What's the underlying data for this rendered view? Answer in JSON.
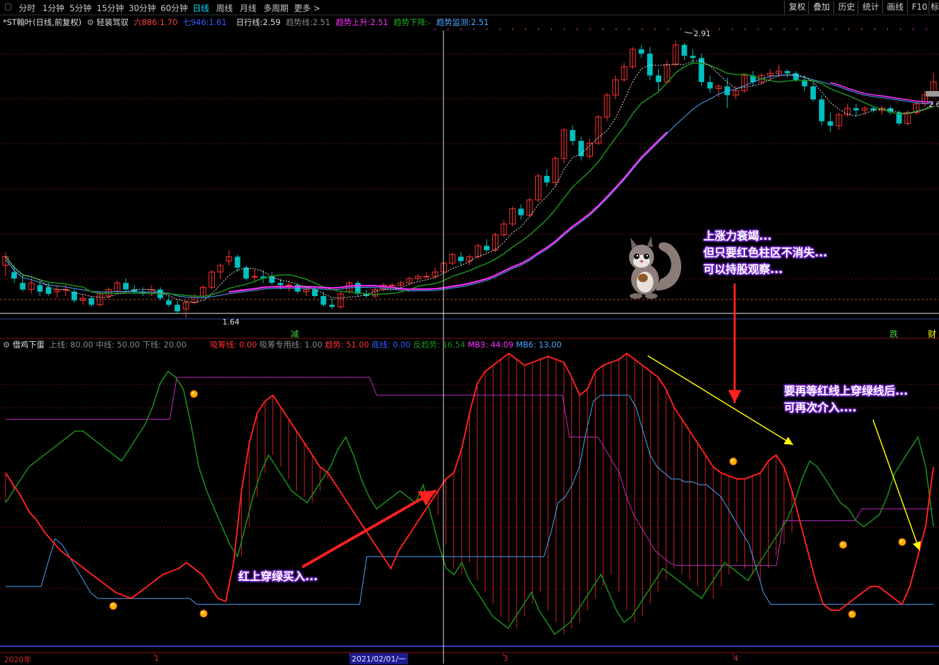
{
  "toolbar": {
    "periods": [
      "分时",
      "1分钟",
      "5分钟",
      "15分钟",
      "30分钟",
      "60分钟",
      "日线",
      "周线",
      "月线",
      "多周期",
      "更多 >"
    ],
    "active_period": "日线",
    "right": [
      "复权",
      "叠加",
      "历史",
      "统计",
      "画线",
      "F10",
      "标"
    ]
  },
  "main_info": {
    "stock": "*ST翰叶(日线,前复权)",
    "indicator": "轻装驾驭",
    "v1_label": "六886:",
    "v1": "1.70",
    "v2_label": "七946:",
    "v2": "1.61",
    "v3_label": "日行线:",
    "v3": "2.59",
    "v4_label": "趋势线:",
    "v4": "2.51",
    "v5_label": "趋势上升:",
    "v5": "2.51",
    "v6_label": "趋势下降:",
    "v6": "-",
    "v7_label": "趋势监测:",
    "v7": "2.51"
  },
  "price_labels": {
    "high": "2.91",
    "low": "1.64",
    "right": "2.6"
  },
  "markers": {
    "m1": "减",
    "m2": "跌",
    "m3": "财"
  },
  "sub_info": {
    "name": "借鸡下蛋",
    "upper": "上线: 80.00",
    "middle": "中线: 50.00",
    "lower": "下线: 20.00",
    "absorb": "吸筹线: 0.00",
    "absorb_special": "吸筹专用线: 1.00",
    "trend": "趋势: 51.00",
    "bottom": "底线: 0.00",
    "reverse": "反趋势: 16.54",
    "mb3": "MB3: 44.09",
    "mb6": "MB6: 13.00"
  },
  "annotations": {
    "a1": [
      "上涨力衰竭...",
      "但只要红色柱区不消失...",
      "可以持股观察..."
    ],
    "a2": [
      "要再等红线上穿绿线后...",
      "可再次介入...."
    ],
    "a3": "红上穿绿买入..."
  },
  "xaxis": {
    "year": "2020年",
    "m1": "1",
    "date": "2021/02/01/一",
    "m3": "3",
    "m4": "4"
  },
  "colors": {
    "up": "#ff3232",
    "down": "#00c0c0",
    "magenta": "#ff30ff",
    "green": "#1a8c1a",
    "blue": "#4aa8ff"
  },
  "chart_data": {
    "type": "candlestick",
    "candles": [
      {
        "o": 1.88,
        "h": 1.94,
        "l": 1.83,
        "c": 1.92
      },
      {
        "o": 1.85,
        "h": 1.88,
        "l": 1.8,
        "c": 1.82
      },
      {
        "o": 1.8,
        "h": 1.84,
        "l": 1.76,
        "c": 1.77
      },
      {
        "o": 1.77,
        "h": 1.82,
        "l": 1.75,
        "c": 1.8
      },
      {
        "o": 1.79,
        "h": 1.81,
        "l": 1.74,
        "c": 1.76
      },
      {
        "o": 1.78,
        "h": 1.8,
        "l": 1.74,
        "c": 1.75
      },
      {
        "o": 1.76,
        "h": 1.79,
        "l": 1.73,
        "c": 1.77
      },
      {
        "o": 1.77,
        "h": 1.79,
        "l": 1.74,
        "c": 1.77
      },
      {
        "o": 1.76,
        "h": 1.77,
        "l": 1.71,
        "c": 1.72
      },
      {
        "o": 1.72,
        "h": 1.75,
        "l": 1.7,
        "c": 1.73
      },
      {
        "o": 1.73,
        "h": 1.74,
        "l": 1.69,
        "c": 1.7
      },
      {
        "o": 1.7,
        "h": 1.76,
        "l": 1.69,
        "c": 1.75
      },
      {
        "o": 1.74,
        "h": 1.78,
        "l": 1.73,
        "c": 1.77
      },
      {
        "o": 1.76,
        "h": 1.81,
        "l": 1.75,
        "c": 1.8
      },
      {
        "o": 1.8,
        "h": 1.82,
        "l": 1.76,
        "c": 1.77
      },
      {
        "o": 1.77,
        "h": 1.79,
        "l": 1.75,
        "c": 1.76
      },
      {
        "o": 1.76,
        "h": 1.78,
        "l": 1.74,
        "c": 1.75
      },
      {
        "o": 1.75,
        "h": 1.79,
        "l": 1.74,
        "c": 1.77
      },
      {
        "o": 1.77,
        "h": 1.78,
        "l": 1.72,
        "c": 1.73
      },
      {
        "o": 1.72,
        "h": 1.74,
        "l": 1.69,
        "c": 1.7
      },
      {
        "o": 1.7,
        "h": 1.72,
        "l": 1.66,
        "c": 1.67
      },
      {
        "o": 1.68,
        "h": 1.72,
        "l": 1.64,
        "c": 1.71
      },
      {
        "o": 1.71,
        "h": 1.75,
        "l": 1.7,
        "c": 1.74
      },
      {
        "o": 1.74,
        "h": 1.79,
        "l": 1.73,
        "c": 1.78
      },
      {
        "o": 1.78,
        "h": 1.86,
        "l": 1.77,
        "c": 1.85
      },
      {
        "o": 1.85,
        "h": 1.89,
        "l": 1.82,
        "c": 1.88
      },
      {
        "o": 1.9,
        "h": 1.95,
        "l": 1.88,
        "c": 1.92
      },
      {
        "o": 1.92,
        "h": 1.93,
        "l": 1.85,
        "c": 1.87
      },
      {
        "o": 1.87,
        "h": 1.88,
        "l": 1.81,
        "c": 1.82
      },
      {
        "o": 1.83,
        "h": 1.86,
        "l": 1.81,
        "c": 1.83
      },
      {
        "o": 1.83,
        "h": 1.86,
        "l": 1.8,
        "c": 1.82
      },
      {
        "o": 1.83,
        "h": 1.85,
        "l": 1.79,
        "c": 1.8
      },
      {
        "o": 1.8,
        "h": 1.82,
        "l": 1.77,
        "c": 1.79
      },
      {
        "o": 1.79,
        "h": 1.81,
        "l": 1.76,
        "c": 1.79
      },
      {
        "o": 1.79,
        "h": 1.8,
        "l": 1.75,
        "c": 1.76
      },
      {
        "o": 1.76,
        "h": 1.78,
        "l": 1.74,
        "c": 1.77
      },
      {
        "o": 1.77,
        "h": 1.78,
        "l": 1.73,
        "c": 1.74
      },
      {
        "o": 1.74,
        "h": 1.76,
        "l": 1.69,
        "c": 1.7
      },
      {
        "o": 1.7,
        "h": 1.73,
        "l": 1.68,
        "c": 1.69
      },
      {
        "o": 1.69,
        "h": 1.76,
        "l": 1.68,
        "c": 1.75
      },
      {
        "o": 1.76,
        "h": 1.81,
        "l": 1.75,
        "c": 1.8
      },
      {
        "o": 1.8,
        "h": 1.81,
        "l": 1.74,
        "c": 1.75
      },
      {
        "o": 1.75,
        "h": 1.77,
        "l": 1.73,
        "c": 1.74
      },
      {
        "o": 1.74,
        "h": 1.78,
        "l": 1.73,
        "c": 1.77
      },
      {
        "o": 1.77,
        "h": 1.8,
        "l": 1.76,
        "c": 1.79
      },
      {
        "o": 1.79,
        "h": 1.8,
        "l": 1.78,
        "c": 1.79
      },
      {
        "o": 1.79,
        "h": 1.81,
        "l": 1.78,
        "c": 1.8
      },
      {
        "o": 1.8,
        "h": 1.83,
        "l": 1.79,
        "c": 1.82
      },
      {
        "o": 1.82,
        "h": 1.84,
        "l": 1.81,
        "c": 1.83
      },
      {
        "o": 1.83,
        "h": 1.85,
        "l": 1.82,
        "c": 1.83
      },
      {
        "o": 1.83,
        "h": 1.87,
        "l": 1.82,
        "c": 1.85
      },
      {
        "o": 1.85,
        "h": 1.9,
        "l": 1.84,
        "c": 1.89
      },
      {
        "o": 1.89,
        "h": 1.94,
        "l": 1.88,
        "c": 1.93
      },
      {
        "o": 1.92,
        "h": 1.94,
        "l": 1.88,
        "c": 1.9
      },
      {
        "o": 1.9,
        "h": 1.93,
        "l": 1.88,
        "c": 1.92
      },
      {
        "o": 1.92,
        "h": 1.98,
        "l": 1.91,
        "c": 1.97
      },
      {
        "o": 1.97,
        "h": 2.0,
        "l": 1.94,
        "c": 1.95
      },
      {
        "o": 1.95,
        "h": 2.03,
        "l": 1.94,
        "c": 2.02
      },
      {
        "o": 2.02,
        "h": 2.09,
        "l": 2.01,
        "c": 2.07
      },
      {
        "o": 2.07,
        "h": 2.15,
        "l": 2.06,
        "c": 2.14
      },
      {
        "o": 2.14,
        "h": 2.16,
        "l": 2.09,
        "c": 2.11
      },
      {
        "o": 2.11,
        "h": 2.19,
        "l": 2.1,
        "c": 2.18
      },
      {
        "o": 2.18,
        "h": 2.3,
        "l": 2.17,
        "c": 2.29
      },
      {
        "o": 2.29,
        "h": 2.32,
        "l": 2.24,
        "c": 2.26
      },
      {
        "o": 2.26,
        "h": 2.38,
        "l": 2.24,
        "c": 2.37
      },
      {
        "o": 2.37,
        "h": 2.51,
        "l": 2.35,
        "c": 2.5
      },
      {
        "o": 2.5,
        "h": 2.52,
        "l": 2.43,
        "c": 2.45
      },
      {
        "o": 2.45,
        "h": 2.47,
        "l": 2.36,
        "c": 2.38
      },
      {
        "o": 2.38,
        "h": 2.46,
        "l": 2.37,
        "c": 2.44
      },
      {
        "o": 2.44,
        "h": 2.57,
        "l": 2.43,
        "c": 2.56
      },
      {
        "o": 2.56,
        "h": 2.67,
        "l": 2.54,
        "c": 2.66
      },
      {
        "o": 2.66,
        "h": 2.75,
        "l": 2.64,
        "c": 2.73
      },
      {
        "o": 2.73,
        "h": 2.81,
        "l": 2.72,
        "c": 2.79
      },
      {
        "o": 2.79,
        "h": 2.88,
        "l": 2.78,
        "c": 2.87
      },
      {
        "o": 2.87,
        "h": 2.89,
        "l": 2.83,
        "c": 2.85
      },
      {
        "o": 2.85,
        "h": 2.88,
        "l": 2.73,
        "c": 2.75
      },
      {
        "o": 2.75,
        "h": 2.78,
        "l": 2.68,
        "c": 2.72
      },
      {
        "o": 2.72,
        "h": 2.82,
        "l": 2.71,
        "c": 2.8
      },
      {
        "o": 2.8,
        "h": 2.91,
        "l": 2.79,
        "c": 2.89
      },
      {
        "o": 2.89,
        "h": 2.9,
        "l": 2.82,
        "c": 2.84
      },
      {
        "o": 2.84,
        "h": 2.87,
        "l": 2.8,
        "c": 2.83
      },
      {
        "o": 2.83,
        "h": 2.85,
        "l": 2.7,
        "c": 2.72
      },
      {
        "o": 2.72,
        "h": 2.75,
        "l": 2.67,
        "c": 2.69
      },
      {
        "o": 2.69,
        "h": 2.71,
        "l": 2.65,
        "c": 2.7
      },
      {
        "o": 2.7,
        "h": 2.74,
        "l": 2.6,
        "c": 2.66
      },
      {
        "o": 2.66,
        "h": 2.7,
        "l": 2.64,
        "c": 2.68
      },
      {
        "o": 2.68,
        "h": 2.76,
        "l": 2.67,
        "c": 2.75
      },
      {
        "o": 2.75,
        "h": 2.77,
        "l": 2.7,
        "c": 2.72
      },
      {
        "o": 2.72,
        "h": 2.76,
        "l": 2.71,
        "c": 2.75
      },
      {
        "o": 2.75,
        "h": 2.78,
        "l": 2.73,
        "c": 2.76
      },
      {
        "o": 2.76,
        "h": 2.8,
        "l": 2.74,
        "c": 2.77
      },
      {
        "o": 2.77,
        "h": 2.78,
        "l": 2.74,
        "c": 2.76
      },
      {
        "o": 2.76,
        "h": 2.77,
        "l": 2.72,
        "c": 2.73
      },
      {
        "o": 2.73,
        "h": 2.75,
        "l": 2.68,
        "c": 2.7
      },
      {
        "o": 2.7,
        "h": 2.72,
        "l": 2.63,
        "c": 2.64
      },
      {
        "o": 2.64,
        "h": 2.66,
        "l": 2.52,
        "c": 2.54
      },
      {
        "o": 2.54,
        "h": 2.58,
        "l": 2.49,
        "c": 2.52
      },
      {
        "o": 2.52,
        "h": 2.58,
        "l": 2.5,
        "c": 2.57
      },
      {
        "o": 2.57,
        "h": 2.62,
        "l": 2.56,
        "c": 2.6
      },
      {
        "o": 2.6,
        "h": 2.62,
        "l": 2.56,
        "c": 2.59
      },
      {
        "o": 2.59,
        "h": 2.61,
        "l": 2.57,
        "c": 2.6
      },
      {
        "o": 2.6,
        "h": 2.61,
        "l": 2.58,
        "c": 2.59
      },
      {
        "o": 2.59,
        "h": 2.61,
        "l": 2.57,
        "c": 2.6
      },
      {
        "o": 2.6,
        "h": 2.61,
        "l": 2.57,
        "c": 2.58
      },
      {
        "o": 2.58,
        "h": 2.59,
        "l": 2.52,
        "c": 2.53
      },
      {
        "o": 2.53,
        "h": 2.59,
        "l": 2.52,
        "c": 2.58
      },
      {
        "o": 2.58,
        "h": 2.63,
        "l": 2.57,
        "c": 2.62
      },
      {
        "o": 2.62,
        "h": 2.68,
        "l": 2.61,
        "c": 2.66
      },
      {
        "o": 2.66,
        "h": 2.76,
        "l": 2.65,
        "c": 2.72
      }
    ]
  }
}
